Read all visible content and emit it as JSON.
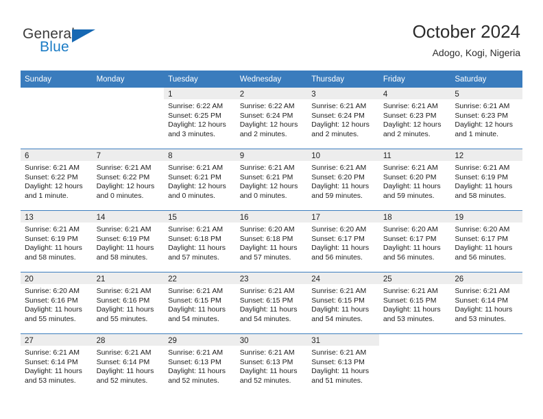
{
  "brand": {
    "name_part1": "General",
    "name_part2": "Blue",
    "triangle_color": "#1668b3",
    "blue_color": "#1a7bc5"
  },
  "header": {
    "title": "October 2024",
    "subtitle": "Adogo, Kogi, Nigeria"
  },
  "theme": {
    "header_blue": "#3a7cbd",
    "daynum_band": "#ededed",
    "text": "#1c1c1c"
  },
  "weekdays": [
    "Sunday",
    "Monday",
    "Tuesday",
    "Wednesday",
    "Thursday",
    "Friday",
    "Saturday"
  ],
  "weeks": [
    [
      {
        "day": "",
        "blank": true,
        "sunrise": "",
        "sunset": "",
        "daylight1": "",
        "daylight2": ""
      },
      {
        "day": "",
        "blank": true,
        "sunrise": "",
        "sunset": "",
        "daylight1": "",
        "daylight2": ""
      },
      {
        "day": "1",
        "sunrise": "Sunrise: 6:22 AM",
        "sunset": "Sunset: 6:25 PM",
        "daylight1": "Daylight: 12 hours",
        "daylight2": "and 3 minutes."
      },
      {
        "day": "2",
        "sunrise": "Sunrise: 6:22 AM",
        "sunset": "Sunset: 6:24 PM",
        "daylight1": "Daylight: 12 hours",
        "daylight2": "and 2 minutes."
      },
      {
        "day": "3",
        "sunrise": "Sunrise: 6:21 AM",
        "sunset": "Sunset: 6:24 PM",
        "daylight1": "Daylight: 12 hours",
        "daylight2": "and 2 minutes."
      },
      {
        "day": "4",
        "sunrise": "Sunrise: 6:21 AM",
        "sunset": "Sunset: 6:23 PM",
        "daylight1": "Daylight: 12 hours",
        "daylight2": "and 2 minutes."
      },
      {
        "day": "5",
        "sunrise": "Sunrise: 6:21 AM",
        "sunset": "Sunset: 6:23 PM",
        "daylight1": "Daylight: 12 hours",
        "daylight2": "and 1 minute."
      }
    ],
    [
      {
        "day": "6",
        "sunrise": "Sunrise: 6:21 AM",
        "sunset": "Sunset: 6:22 PM",
        "daylight1": "Daylight: 12 hours",
        "daylight2": "and 1 minute."
      },
      {
        "day": "7",
        "sunrise": "Sunrise: 6:21 AM",
        "sunset": "Sunset: 6:22 PM",
        "daylight1": "Daylight: 12 hours",
        "daylight2": "and 0 minutes."
      },
      {
        "day": "8",
        "sunrise": "Sunrise: 6:21 AM",
        "sunset": "Sunset: 6:21 PM",
        "daylight1": "Daylight: 12 hours",
        "daylight2": "and 0 minutes."
      },
      {
        "day": "9",
        "sunrise": "Sunrise: 6:21 AM",
        "sunset": "Sunset: 6:21 PM",
        "daylight1": "Daylight: 12 hours",
        "daylight2": "and 0 minutes."
      },
      {
        "day": "10",
        "sunrise": "Sunrise: 6:21 AM",
        "sunset": "Sunset: 6:20 PM",
        "daylight1": "Daylight: 11 hours",
        "daylight2": "and 59 minutes."
      },
      {
        "day": "11",
        "sunrise": "Sunrise: 6:21 AM",
        "sunset": "Sunset: 6:20 PM",
        "daylight1": "Daylight: 11 hours",
        "daylight2": "and 59 minutes."
      },
      {
        "day": "12",
        "sunrise": "Sunrise: 6:21 AM",
        "sunset": "Sunset: 6:19 PM",
        "daylight1": "Daylight: 11 hours",
        "daylight2": "and 58 minutes."
      }
    ],
    [
      {
        "day": "13",
        "sunrise": "Sunrise: 6:21 AM",
        "sunset": "Sunset: 6:19 PM",
        "daylight1": "Daylight: 11 hours",
        "daylight2": "and 58 minutes."
      },
      {
        "day": "14",
        "sunrise": "Sunrise: 6:21 AM",
        "sunset": "Sunset: 6:19 PM",
        "daylight1": "Daylight: 11 hours",
        "daylight2": "and 58 minutes."
      },
      {
        "day": "15",
        "sunrise": "Sunrise: 6:21 AM",
        "sunset": "Sunset: 6:18 PM",
        "daylight1": "Daylight: 11 hours",
        "daylight2": "and 57 minutes."
      },
      {
        "day": "16",
        "sunrise": "Sunrise: 6:20 AM",
        "sunset": "Sunset: 6:18 PM",
        "daylight1": "Daylight: 11 hours",
        "daylight2": "and 57 minutes."
      },
      {
        "day": "17",
        "sunrise": "Sunrise: 6:20 AM",
        "sunset": "Sunset: 6:17 PM",
        "daylight1": "Daylight: 11 hours",
        "daylight2": "and 56 minutes."
      },
      {
        "day": "18",
        "sunrise": "Sunrise: 6:20 AM",
        "sunset": "Sunset: 6:17 PM",
        "daylight1": "Daylight: 11 hours",
        "daylight2": "and 56 minutes."
      },
      {
        "day": "19",
        "sunrise": "Sunrise: 6:20 AM",
        "sunset": "Sunset: 6:17 PM",
        "daylight1": "Daylight: 11 hours",
        "daylight2": "and 56 minutes."
      }
    ],
    [
      {
        "day": "20",
        "sunrise": "Sunrise: 6:20 AM",
        "sunset": "Sunset: 6:16 PM",
        "daylight1": "Daylight: 11 hours",
        "daylight2": "and 55 minutes."
      },
      {
        "day": "21",
        "sunrise": "Sunrise: 6:21 AM",
        "sunset": "Sunset: 6:16 PM",
        "daylight1": "Daylight: 11 hours",
        "daylight2": "and 55 minutes."
      },
      {
        "day": "22",
        "sunrise": "Sunrise: 6:21 AM",
        "sunset": "Sunset: 6:15 PM",
        "daylight1": "Daylight: 11 hours",
        "daylight2": "and 54 minutes."
      },
      {
        "day": "23",
        "sunrise": "Sunrise: 6:21 AM",
        "sunset": "Sunset: 6:15 PM",
        "daylight1": "Daylight: 11 hours",
        "daylight2": "and 54 minutes."
      },
      {
        "day": "24",
        "sunrise": "Sunrise: 6:21 AM",
        "sunset": "Sunset: 6:15 PM",
        "daylight1": "Daylight: 11 hours",
        "daylight2": "and 54 minutes."
      },
      {
        "day": "25",
        "sunrise": "Sunrise: 6:21 AM",
        "sunset": "Sunset: 6:15 PM",
        "daylight1": "Daylight: 11 hours",
        "daylight2": "and 53 minutes."
      },
      {
        "day": "26",
        "sunrise": "Sunrise: 6:21 AM",
        "sunset": "Sunset: 6:14 PM",
        "daylight1": "Daylight: 11 hours",
        "daylight2": "and 53 minutes."
      }
    ],
    [
      {
        "day": "27",
        "sunrise": "Sunrise: 6:21 AM",
        "sunset": "Sunset: 6:14 PM",
        "daylight1": "Daylight: 11 hours",
        "daylight2": "and 53 minutes."
      },
      {
        "day": "28",
        "sunrise": "Sunrise: 6:21 AM",
        "sunset": "Sunset: 6:14 PM",
        "daylight1": "Daylight: 11 hours",
        "daylight2": "and 52 minutes."
      },
      {
        "day": "29",
        "sunrise": "Sunrise: 6:21 AM",
        "sunset": "Sunset: 6:13 PM",
        "daylight1": "Daylight: 11 hours",
        "daylight2": "and 52 minutes."
      },
      {
        "day": "30",
        "sunrise": "Sunrise: 6:21 AM",
        "sunset": "Sunset: 6:13 PM",
        "daylight1": "Daylight: 11 hours",
        "daylight2": "and 52 minutes."
      },
      {
        "day": "31",
        "sunrise": "Sunrise: 6:21 AM",
        "sunset": "Sunset: 6:13 PM",
        "daylight1": "Daylight: 11 hours",
        "daylight2": "and 51 minutes."
      },
      {
        "day": "",
        "blank": true,
        "sunrise": "",
        "sunset": "",
        "daylight1": "",
        "daylight2": ""
      },
      {
        "day": "",
        "blank": true,
        "sunrise": "",
        "sunset": "",
        "daylight1": "",
        "daylight2": ""
      }
    ]
  ]
}
